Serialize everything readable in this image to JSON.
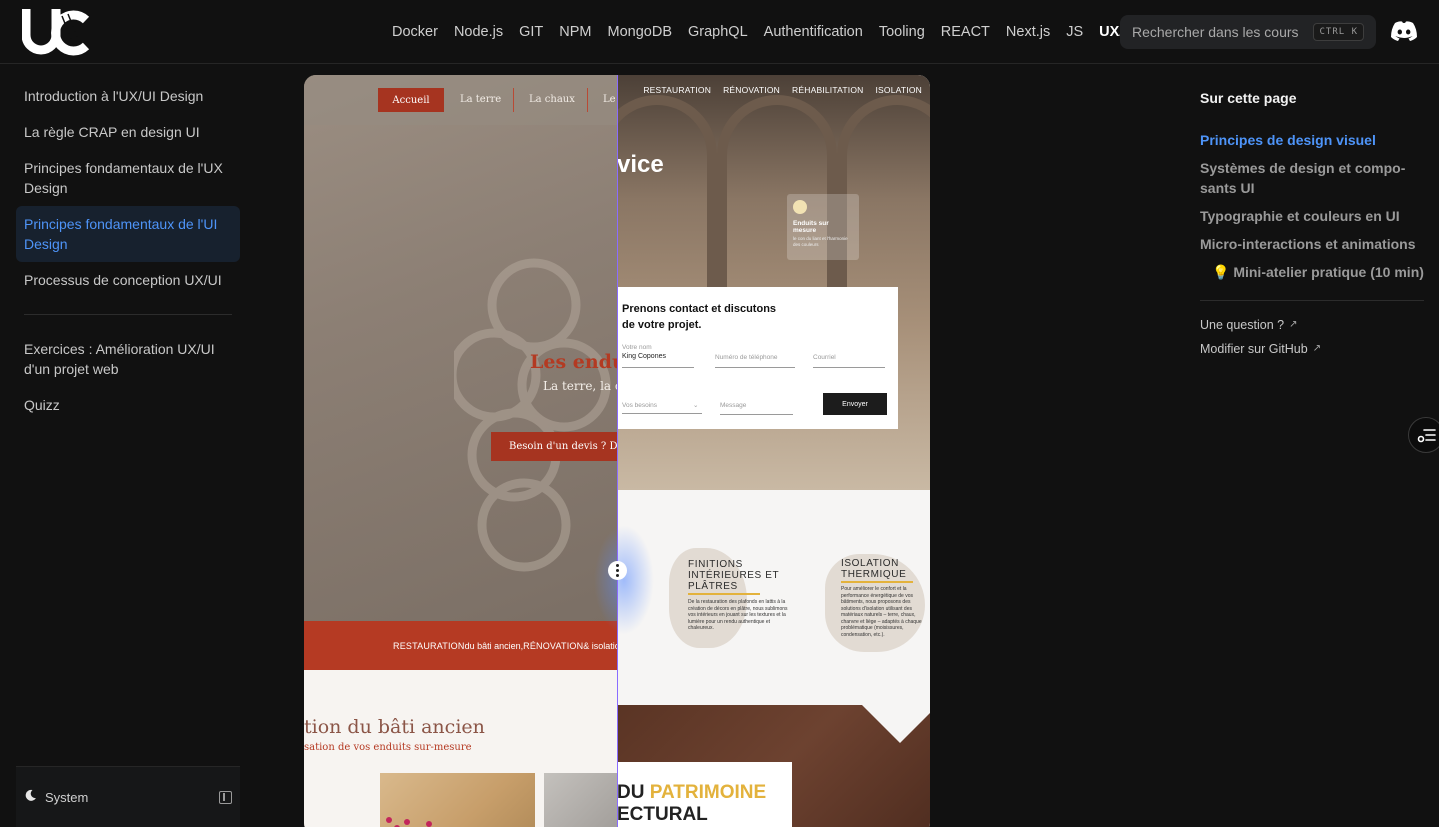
{
  "nav": {
    "items": [
      "Docker",
      "Node.js",
      "GIT",
      "NPM",
      "MongoDB",
      "GraphQL",
      "Authentification",
      "Tooling",
      "REACT",
      "Next.js",
      "JS",
      "UX/UI"
    ],
    "active_index": 11,
    "search_placeholder": "Rechercher dans les cours",
    "search_shortcut": "CTRL K"
  },
  "sidebar": {
    "items": [
      {
        "label": "Introduction à l'UX/UI Design"
      },
      {
        "label": "La règle CRAP en design UI"
      },
      {
        "label": "Principes fondamentaux de l'UX Design"
      },
      {
        "label": "Principes fondamentaux de l'UI Design",
        "active": true
      },
      {
        "label": "Processus de conception UX/UI"
      }
    ],
    "items2": [
      {
        "label": "Exercices : Amélioration UX/UI d'un projet web"
      },
      {
        "label": "Quizz"
      }
    ],
    "theme_label": "System"
  },
  "compare": {
    "left": {
      "nav": [
        "Accueil",
        "La terre",
        "La chaux",
        "Le"
      ],
      "hero_title": "Les enduits",
      "hero_sub": "La terre, la c",
      "cta": "Besoin d'un devis ? De",
      "band_strong1": "RESTAURATION",
      "band_text1": " du bâti ancien, ",
      "band_strong2": "RÉNOVATION",
      "band_text2": " & isolatio",
      "section_title": "tion du bâti ancien",
      "section_sub": "sation de vos enduits sur-mesure"
    },
    "right": {
      "nav": [
        "RESTAURATION",
        "RÉNOVATION",
        "RÉHABILITATION",
        "ISOLATION"
      ],
      "hero_word": "vice",
      "card_title": "Enduits sur mesure",
      "card_sub": "le con du liant et l'harmonie des couleurs",
      "form_title_1": "Prenons contact et discutons",
      "form_title_2": "de votre projet.",
      "form_name_label": "Votre nom",
      "form_name_value": "King Copones",
      "form_phone": "Numéro de téléphone",
      "form_email": "Courriel",
      "form_needs": "Vos besoins",
      "form_message": "Message",
      "form_send": "Envoyer",
      "col1_title_1": "FINITIONS",
      "col1_title_2": "INTÉRIEURES ET",
      "col1_title_3": "PLÂTRES",
      "col1_text": "De la restauration des plafonds en lattis à la création de décors en plâtre, nous sublimons vos intérieurs en jouant sur les textures et la lumière pour un rendu authentique et chaleureux.",
      "col2_title_1": "ISOLATION",
      "col2_title_2": "THERMIQUE",
      "col2_text": "Pour améliorer le confort et la performance énergétique de vos bâtiments, nous proposons des solutions d'isolation utilisant des matériaux naturels – terre, chaux, chanvre et liège – adaptés à chaque problématique (moisissures, condensation, etc.).",
      "patri_1a": "DU ",
      "patri_1b": "PATRIMOINE",
      "patri_2": "ECTURAL"
    }
  },
  "toc": {
    "title": "Sur cette page",
    "items": [
      {
        "label": "Principes de design visuel",
        "active": true
      },
      {
        "label": "Systèmes de design et compo­sants UI"
      },
      {
        "label": "Typographie et couleurs en UI"
      },
      {
        "label": "Micro-interactions et animations"
      },
      {
        "label": "💡 Mini-atelier pratique (10 min)",
        "sub": true
      }
    ],
    "question_link": "Une question ?",
    "github_link": "Modifier sur GitHub"
  },
  "colors": {
    "accent": "#4e94f8",
    "background": "#111111",
    "terracotta": "#a63420",
    "gold": "#e3b23c"
  },
  "icons": [
    "uc-logo-icon",
    "discord-icon",
    "moon-icon",
    "sidebar-collapse-icon",
    "external-link-icon",
    "toc-menu-icon",
    "drag-handle-icon"
  ]
}
